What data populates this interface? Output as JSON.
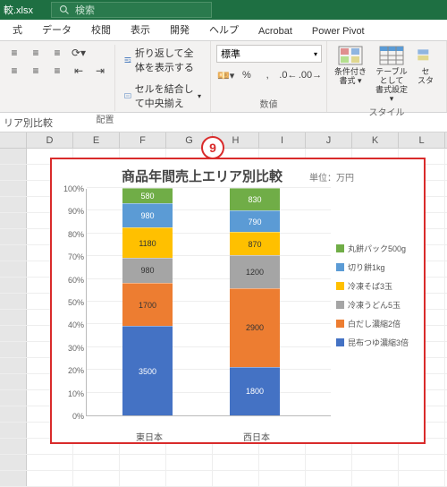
{
  "titlebar": {
    "filename": "較.xlsx",
    "search_placeholder": "検索"
  },
  "tabs": [
    "式",
    "データ",
    "校閲",
    "表示",
    "開発",
    "ヘルプ",
    "Acrobat",
    "Power Pivot"
  ],
  "ribbon": {
    "align_group_label": "配置",
    "wrap_label": "折り返して全体を表示する",
    "merge_label": "セルを結合して中央揃え",
    "number_group_label": "数値",
    "number_format": "標準",
    "style_group_label": "スタイル",
    "cond_fmt_line1": "条件付き",
    "cond_fmt_line2": "書式 ▾",
    "table_fmt_line1": "テーブルとして",
    "table_fmt_line2": "書式設定 ▾",
    "cell_style_line1": "セ",
    "cell_style_line2": "スタ"
  },
  "formulabar": {
    "text": "リア別比較"
  },
  "columns": [
    "D",
    "E",
    "F",
    "G",
    "H",
    "I",
    "J",
    "K",
    "L"
  ],
  "annotation": "9",
  "chart_data": {
    "type": "stacked_bar_100",
    "title": "商品年間売上エリア別比較",
    "unit": "単位：万円",
    "ylabel": "",
    "yticks": [
      "0%",
      "10%",
      "20%",
      "30%",
      "40%",
      "50%",
      "60%",
      "70%",
      "80%",
      "90%",
      "100%"
    ],
    "categories": [
      "東日本",
      "西日本"
    ],
    "series": [
      {
        "name": "昆布つゆ濃縮3倍",
        "color": "#4472c4",
        "values": [
          3500,
          1800
        ]
      },
      {
        "name": "白だし濃縮2倍",
        "color": "#ed7d31",
        "values": [
          1700,
          2900
        ]
      },
      {
        "name": "冷凍うどん5玉",
        "color": "#a5a5a5",
        "values": [
          980,
          1200
        ]
      },
      {
        "name": "冷凍そば3玉",
        "color": "#ffc000",
        "values": [
          1180,
          870
        ]
      },
      {
        "name": "切り餅1kg",
        "color": "#5b9bd5",
        "values": [
          980,
          790
        ]
      },
      {
        "name": "丸餅パック500g",
        "color": "#70ad47",
        "values": [
          580,
          830
        ]
      }
    ]
  }
}
